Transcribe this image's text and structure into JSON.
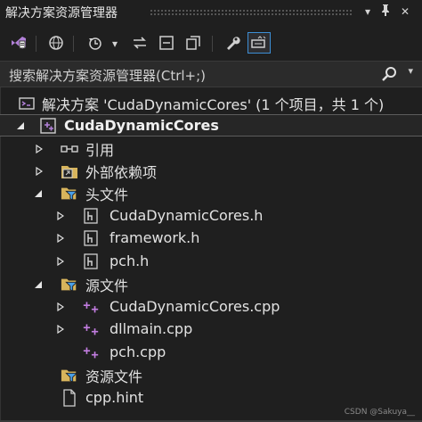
{
  "window": {
    "title": "解决方案资源管理器",
    "dropdown_glyph": "▾",
    "pin_glyph": "📌",
    "close_glyph": "✕"
  },
  "toolbar": {
    "items": [
      {
        "name": "vs-switch-views-icon"
      },
      {
        "name": "globe-icon"
      },
      {
        "name": "history-clock-icon"
      },
      {
        "name": "sync-arrows-icon"
      },
      {
        "name": "collapse-all-icon"
      },
      {
        "name": "show-all-files-icon"
      },
      {
        "name": "properties-wrench-icon"
      },
      {
        "name": "preview-selected-icon",
        "active": true
      }
    ],
    "dropdown_glyph": "▾"
  },
  "search": {
    "placeholder": "搜索解决方案资源管理器(Ctrl+;)",
    "dropdown_glyph": "▾"
  },
  "tree": {
    "solution": "解决方案 'CudaDynamicCores' (1 个项目，共 1 个)",
    "project": "CudaDynamicCores",
    "references": "引用",
    "external_deps": "外部依赖项",
    "header_files": "头文件",
    "headers": [
      "CudaDynamicCores.h",
      "framework.h",
      "pch.h"
    ],
    "source_files": "源文件",
    "sources": [
      "CudaDynamicCores.cpp",
      "dllmain.cpp",
      "pch.cpp"
    ],
    "resource_files": "资源文件",
    "hint_file": "cpp.hint"
  },
  "watermark": "CSDN @Sakuya__",
  "colors": {
    "background": "#1f1f1f",
    "accent": "#3d8fd6",
    "folder": "#d7b45c",
    "cpp": "#c27de0",
    "filter": "#4aa0e8"
  }
}
